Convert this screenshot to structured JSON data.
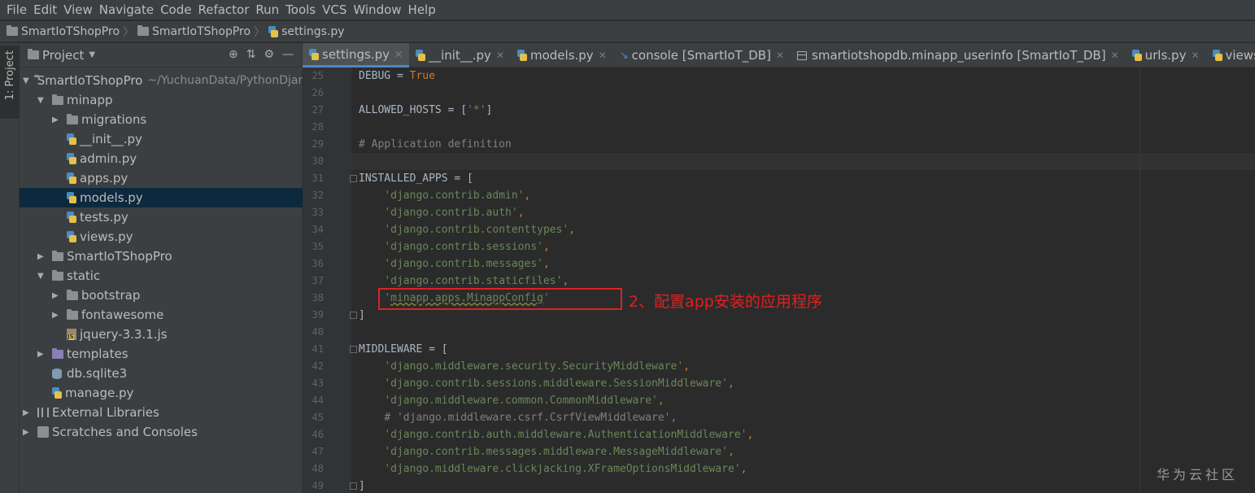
{
  "menu": [
    "File",
    "Edit",
    "View",
    "Navigate",
    "Code",
    "Refactor",
    "Run",
    "Tools",
    "VCS",
    "Window",
    "Help"
  ],
  "breadcrumb": [
    "SmartIoTShopPro",
    "SmartIoTShopPro",
    "settings.py"
  ],
  "stripe_label": "1: Project",
  "panel": {
    "title": "Project"
  },
  "tree": [
    {
      "label": "SmartIoTShopPro",
      "extra": "~/YuchuanData/PythonDjan",
      "icon": "folder",
      "arrow": "down"
    },
    {
      "label": "minapp",
      "icon": "folder",
      "arrow": "down"
    },
    {
      "label": "migrations",
      "icon": "folder",
      "arrow": "right"
    },
    {
      "label": "__init__.py",
      "icon": "python"
    },
    {
      "label": "admin.py",
      "icon": "python"
    },
    {
      "label": "apps.py",
      "icon": "python"
    },
    {
      "label": "models.py",
      "icon": "python",
      "selected": true
    },
    {
      "label": "tests.py",
      "icon": "python"
    },
    {
      "label": "views.py",
      "icon": "python"
    },
    {
      "label": "SmartIoTShopPro",
      "icon": "folder",
      "arrow": "right"
    },
    {
      "label": "static",
      "icon": "folder",
      "arrow": "down"
    },
    {
      "label": "bootstrap",
      "icon": "folder",
      "arrow": "right"
    },
    {
      "label": "fontawesome",
      "icon": "folder",
      "arrow": "right"
    },
    {
      "label": "jquery-3.3.1.js",
      "icon": "js"
    },
    {
      "label": "templates",
      "icon": "folder-purple",
      "arrow": "right"
    },
    {
      "label": "db.sqlite3",
      "icon": "database"
    },
    {
      "label": "manage.py",
      "icon": "python"
    },
    {
      "label": "External Libraries",
      "icon": "library",
      "arrow": "right"
    },
    {
      "label": "Scratches and Consoles",
      "icon": "scratch",
      "arrow": "right"
    }
  ],
  "tabs": [
    {
      "label": "settings.py",
      "icon": "python",
      "active": true
    },
    {
      "label": "__init__.py",
      "icon": "python"
    },
    {
      "label": "models.py",
      "icon": "python"
    },
    {
      "label": "console [SmartIoT_DB]",
      "icon": "console"
    },
    {
      "label": "smartiotshopdb.minapp_userinfo [SmartIoT_DB]",
      "icon": "table"
    },
    {
      "label": "urls.py",
      "icon": "python"
    },
    {
      "label": "views.py",
      "icon": "python"
    }
  ],
  "code_lines": [
    {
      "no": "25",
      "segments": [
        [
          "DEBUG = ",
          "plain"
        ],
        [
          "True",
          "kw"
        ]
      ]
    },
    {
      "no": "26",
      "segments": []
    },
    {
      "no": "27",
      "segments": [
        [
          "ALLOWED_HOSTS = [",
          "plain"
        ],
        [
          "'*'",
          "str"
        ],
        [
          "]",
          "plain"
        ]
      ]
    },
    {
      "no": "28",
      "segments": []
    },
    {
      "no": "29",
      "segments": [
        [
          "# Application definition",
          "cmt"
        ]
      ]
    },
    {
      "no": "30",
      "segments": []
    },
    {
      "no": "31",
      "segments": [
        [
          "INSTALLED_APPS = [",
          "plain"
        ]
      ]
    },
    {
      "no": "32",
      "segments": [
        [
          "    ",
          "plain"
        ],
        [
          "'django.contrib.admin'",
          "str"
        ],
        [
          ",",
          "kw"
        ]
      ]
    },
    {
      "no": "33",
      "segments": [
        [
          "    ",
          "plain"
        ],
        [
          "'django.contrib.auth'",
          "str"
        ],
        [
          ",",
          "kw"
        ]
      ]
    },
    {
      "no": "34",
      "segments": [
        [
          "    ",
          "plain"
        ],
        [
          "'django.contrib.contenttypes'",
          "str"
        ],
        [
          ",",
          "kw"
        ]
      ]
    },
    {
      "no": "35",
      "segments": [
        [
          "    ",
          "plain"
        ],
        [
          "'django.contrib.sessions'",
          "str"
        ],
        [
          ",",
          "kw"
        ]
      ]
    },
    {
      "no": "36",
      "segments": [
        [
          "    ",
          "plain"
        ],
        [
          "'django.contrib.messages'",
          "str"
        ],
        [
          ",",
          "kw"
        ]
      ]
    },
    {
      "no": "37",
      "segments": [
        [
          "    ",
          "plain"
        ],
        [
          "'django.contrib.staticfiles'",
          "str"
        ],
        [
          ",",
          "kw"
        ]
      ]
    },
    {
      "no": "38",
      "segments": [
        [
          "    ",
          "plain"
        ],
        [
          "'minapp.apps.MinappConfig'",
          "str-squiggle"
        ]
      ]
    },
    {
      "no": "39",
      "segments": [
        [
          "]",
          "plain"
        ]
      ]
    },
    {
      "no": "40",
      "segments": []
    },
    {
      "no": "41",
      "segments": [
        [
          "MIDDLEWARE = [",
          "plain"
        ]
      ]
    },
    {
      "no": "42",
      "segments": [
        [
          "    ",
          "plain"
        ],
        [
          "'django.middleware.security.SecurityMiddleware'",
          "str"
        ],
        [
          ",",
          "kw"
        ]
      ]
    },
    {
      "no": "43",
      "segments": [
        [
          "    ",
          "plain"
        ],
        [
          "'django.contrib.sessions.middleware.SessionMiddleware'",
          "str"
        ],
        [
          ",",
          "kw"
        ]
      ]
    },
    {
      "no": "44",
      "segments": [
        [
          "    ",
          "plain"
        ],
        [
          "'django.middleware.common.CommonMiddleware'",
          "str"
        ],
        [
          ",",
          "kw"
        ]
      ]
    },
    {
      "no": "45",
      "segments": [
        [
          "    ",
          "plain"
        ],
        [
          "# 'django.middleware.csrf.CsrfViewMiddleware',",
          "cmt"
        ]
      ]
    },
    {
      "no": "46",
      "segments": [
        [
          "    ",
          "plain"
        ],
        [
          "'django.contrib.auth.middleware.AuthenticationMiddleware'",
          "str"
        ],
        [
          ",",
          "kw"
        ]
      ]
    },
    {
      "no": "47",
      "segments": [
        [
          "    ",
          "plain"
        ],
        [
          "'django.contrib.messages.middleware.MessageMiddleware'",
          "str"
        ],
        [
          ",",
          "kw"
        ]
      ]
    },
    {
      "no": "48",
      "segments": [
        [
          "    ",
          "plain"
        ],
        [
          "'django.middleware.clickjacking.XFrameOptionsMiddleware'",
          "str"
        ],
        [
          ",",
          "kw"
        ]
      ]
    },
    {
      "no": "49",
      "segments": [
        [
          "]",
          "plain"
        ]
      ]
    }
  ],
  "annotation": "2、配置app安装的应用程序",
  "watermark": "华为云社区",
  "colors": {
    "annotation": "#e02020",
    "keyword": "#cc7832",
    "string": "#6a8759",
    "comment": "#808080"
  }
}
